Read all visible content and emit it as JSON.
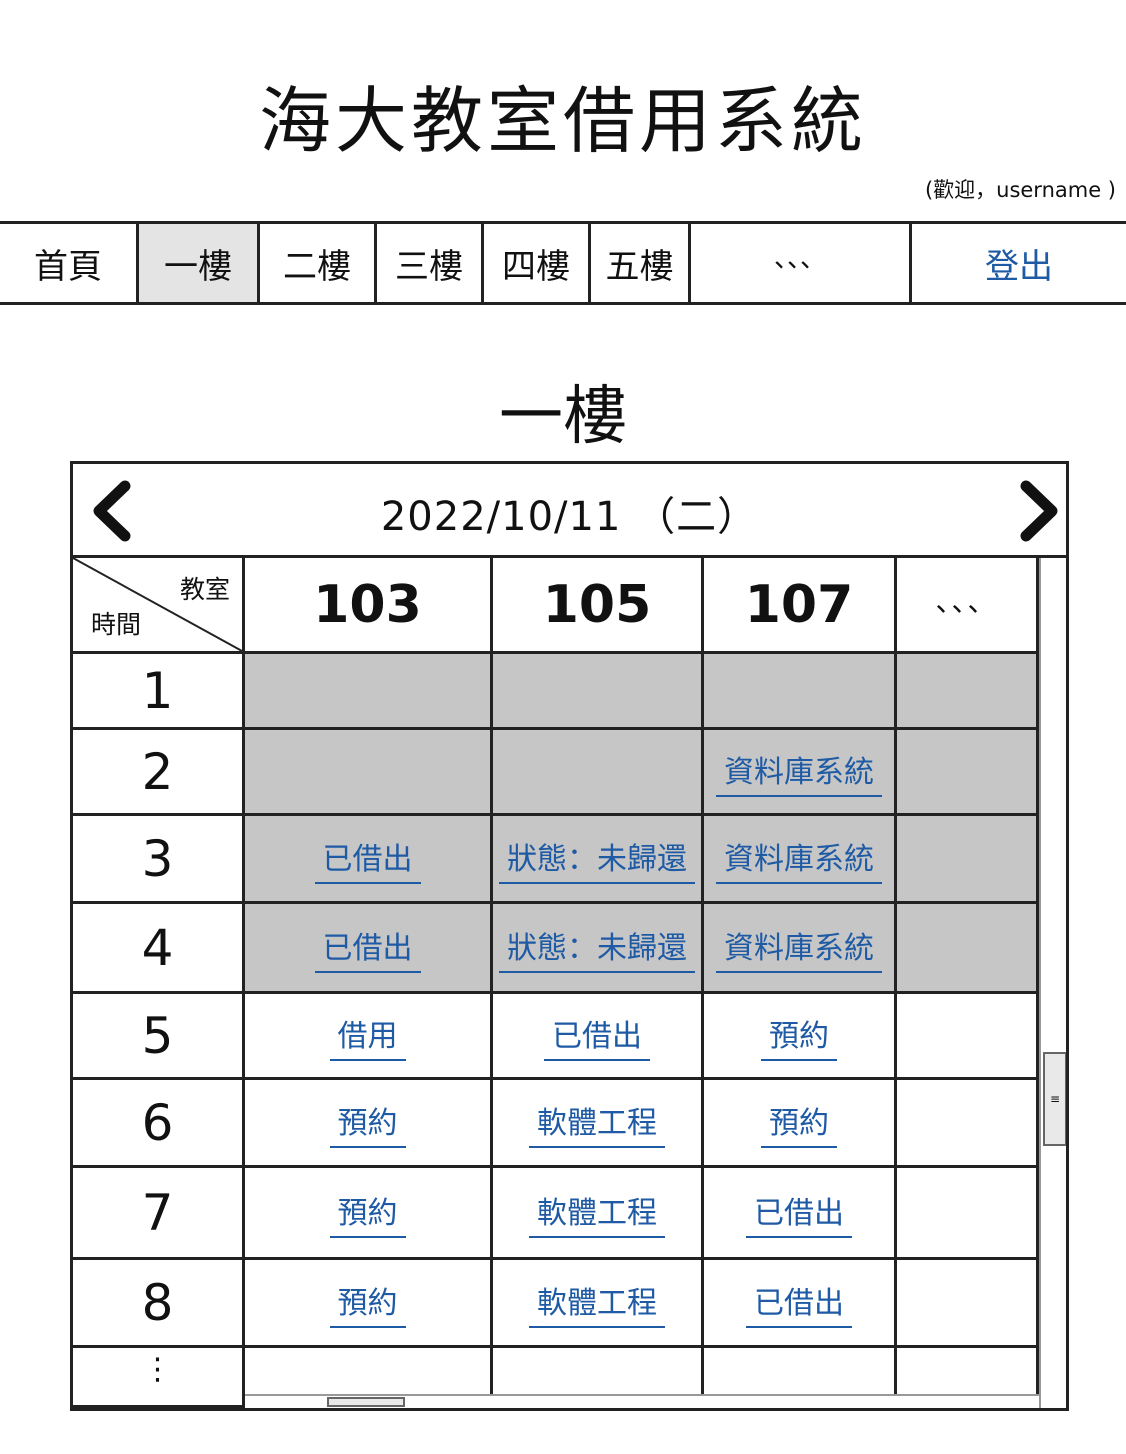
{
  "header": {
    "title": "海大教室借用系統",
    "welcome": "(歡迎，username )"
  },
  "nav": {
    "items": [
      {
        "label": "首頁"
      },
      {
        "label": "一樓"
      },
      {
        "label": "二樓"
      },
      {
        "label": "三樓"
      },
      {
        "label": "四樓"
      },
      {
        "label": "五樓"
      },
      {
        "label": "、、、"
      }
    ],
    "active_item": "一樓",
    "logout": "登出"
  },
  "floor": {
    "title": "一樓"
  },
  "schedule": {
    "date": "2022/10/11 （二）",
    "corner_room": "教室",
    "corner_time": "時間",
    "rooms": [
      "103",
      "105",
      "107",
      "、、、"
    ],
    "times": [
      "1",
      "2",
      "3",
      "4",
      "5",
      "6",
      "7",
      "8",
      "⋮"
    ],
    "cells": [
      [
        "",
        "",
        "",
        ""
      ],
      [
        "",
        "",
        "資料庫系統",
        ""
      ],
      [
        "已借出",
        "狀態：未歸還",
        "資料庫系統",
        ""
      ],
      [
        "已借出",
        "狀態：未歸還",
        "資料庫系統",
        ""
      ],
      [
        "借用",
        "已借出",
        "預約",
        ""
      ],
      [
        "預約",
        "軟體工程",
        "預約",
        ""
      ],
      [
        "預約",
        "軟體工程",
        "已借出",
        ""
      ],
      [
        "預約",
        "軟體工程",
        "已借出",
        ""
      ],
      [
        "",
        "",
        "",
        ""
      ]
    ]
  },
  "colors": {
    "link": "#1f5aa5",
    "shaded": "#c6c6c6",
    "active_tab": "#e4e4e4"
  }
}
